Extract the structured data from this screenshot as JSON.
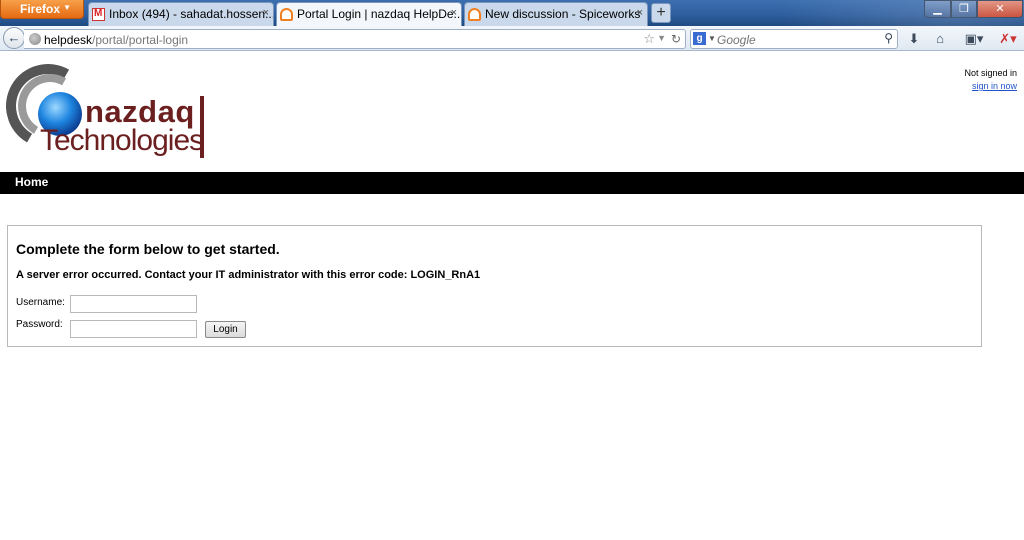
{
  "browser": {
    "app_button": "Firefox",
    "tabs": [
      {
        "label": "Inbox (494) - sahadat.hossen...",
        "favicon": "gmail-icon",
        "active": false
      },
      {
        "label": "Portal Login | nazdaq HelpDe...",
        "favicon": "spiceworks-icon",
        "active": true
      },
      {
        "label": "New discussion - Spiceworks",
        "favicon": "spiceworks-icon",
        "active": false
      }
    ],
    "new_tab": "+",
    "close_glyph": "×",
    "url": {
      "host": "helpdesk",
      "path": "/portal/portal-login"
    },
    "search": {
      "placeholder": "Google",
      "engine_letter": "g"
    }
  },
  "header": {
    "logo": {
      "name": "nazdaq",
      "sub": "Technologies"
    },
    "status": "Not signed in",
    "signin_link": "sign in now"
  },
  "menu": {
    "home": "Home"
  },
  "form": {
    "title": "Complete the form below to get started.",
    "error": "A server error occurred. Contact your IT administrator with this error code: LOGIN_RnA1",
    "username_label": "Username:",
    "password_label": "Password:",
    "username_value": "",
    "password_value": "",
    "login_button": "Login"
  },
  "colors": {
    "brand": "#6b1f1f",
    "menubar": "#000000",
    "link": "#2255cc"
  }
}
